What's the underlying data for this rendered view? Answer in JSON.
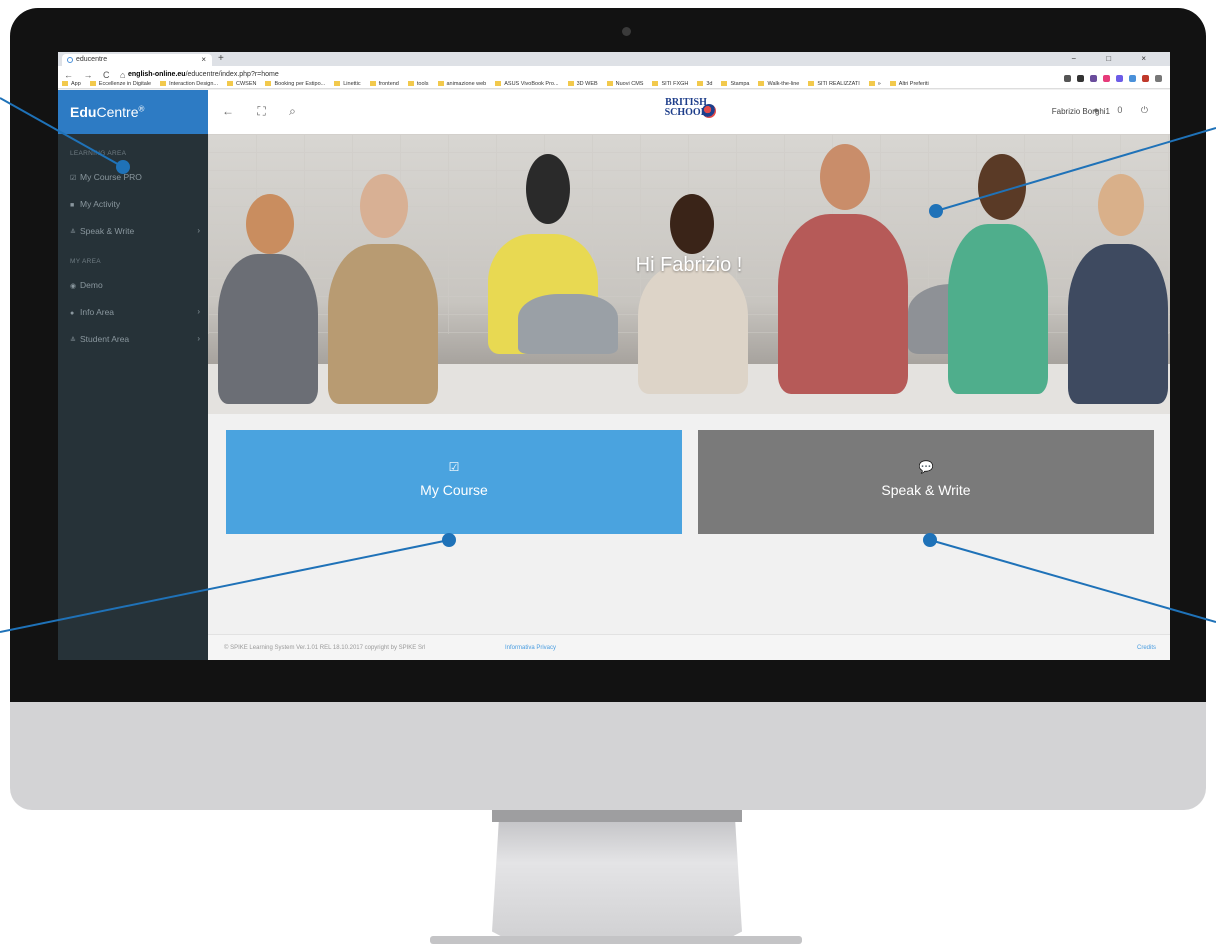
{
  "browser": {
    "tab_title": "educentre",
    "tab_close": "×",
    "new_tab": "+",
    "window_controls": "− □ ×",
    "nav_buttons": "← → C ⌂",
    "url_host": "english-online.eu",
    "url_path": "/educentre/index.php?r=home",
    "bookmarks": [
      "App",
      "Eccellenze in Digitale",
      "Interaction Design...",
      "CWSEN",
      "Booking per Estipo...",
      "Linettic",
      "frontend",
      "tools",
      "animazione web",
      "ASUS VivoBook Pro...",
      "3D WEB",
      "Nuovi CMS",
      "SITI FXGH",
      "3d",
      "Stampa",
      "Walk-the-line",
      "SITI REALIZZATI",
      "»",
      "Altri Preferiti"
    ],
    "extension_colors": [
      "#555555",
      "#333333",
      "#6a4c9c",
      "#e63b7a",
      "#6c5ce7",
      "#4a90d9",
      "#c0392b",
      "#777777"
    ]
  },
  "sidebar": {
    "brand_bold": "Edu",
    "brand_rest": "Centre",
    "brand_mark": "®",
    "learning_area_label": "LEARNING AREA",
    "learning_items": [
      {
        "icon": "☑",
        "label": "My Course PRO",
        "has_children": false
      },
      {
        "icon": "■",
        "label": "My Activity",
        "has_children": false
      },
      {
        "icon": "≗",
        "label": "Speak & Write",
        "has_children": true
      }
    ],
    "my_area_label": "MY AREA",
    "my_items": [
      {
        "icon": "◉",
        "label": "Demo",
        "has_children": false
      },
      {
        "icon": "●",
        "label": "Info Area",
        "has_children": true
      },
      {
        "icon": "≗",
        "label": "Student Area",
        "has_children": true
      }
    ],
    "chevron": "›"
  },
  "topbar": {
    "icons": "← ⛶ ⌕",
    "school_line1": "BRITISH",
    "school_line2": "SCHOOL",
    "user_name": "Fabrizio Borghi1",
    "right_icons": "● 0 ⏻"
  },
  "hero": {
    "greeting": "Hi Fabrizio !"
  },
  "cards": [
    {
      "icon": "☑",
      "label": "My Course",
      "color": "#4aa3df"
    },
    {
      "icon": "💬",
      "label": "Speak & Write",
      "color": "#7a7a7a"
    }
  ],
  "footer": {
    "copyright": "© SPIKE Learning System Ver.1.01 REL 18.10.2017 copyright by SPIKE Srl",
    "privacy": "Informativa Privacy",
    "credits": "Credits"
  },
  "colors": {
    "callout": "#1f72b8",
    "sidebar": "#263238",
    "brand_bar": "#2d7bc4"
  }
}
